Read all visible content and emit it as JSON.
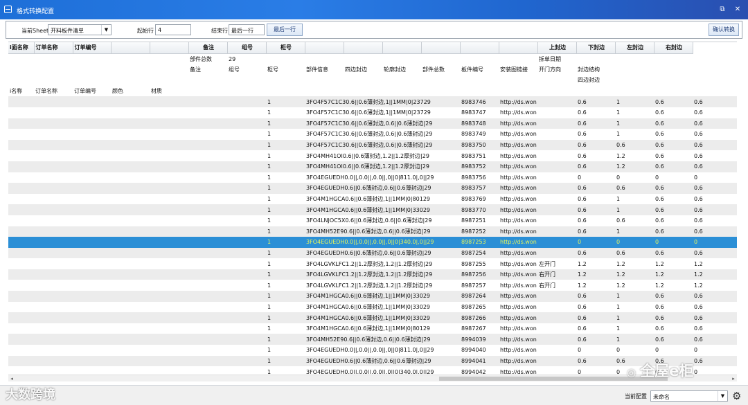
{
  "window": {
    "title": "格式转换配置",
    "restore_glyph": "⧉",
    "close_glyph": "✕"
  },
  "toolbar": {
    "sheet_label": "当前Sheet",
    "sheet_value": "开料板件清单",
    "start_label": "起始行",
    "start_value": "4",
    "end_label": "结束行",
    "end_value": "最后一行",
    "end_button": "最后一行",
    "confirm_button": "确认转换"
  },
  "grid": {
    "headers": [
      "i面名称",
      "订单名称",
      "订单编号",
      "",
      "",
      "备注",
      "组号",
      "柜号",
      "",
      "",
      "",
      "",
      "",
      "",
      "上封边",
      "下封边",
      "左封边",
      "右封边"
    ],
    "info_rows": [
      [
        "",
        "",
        "",
        "",
        "",
        "部件总数",
        "29",
        "",
        "",
        "",
        "",
        "",
        "",
        "",
        "拆单日期",
        "",
        "",
        ""
      ],
      [
        "",
        "",
        "",
        "",
        "",
        "备注",
        "组号",
        "柜号",
        "部件信息",
        "四边封边",
        "轮廓封边",
        "部件总数",
        "板件编号",
        "安装图链接",
        "开门方向",
        "封边结构",
        "",
        ""
      ],
      [
        "",
        "",
        "",
        "",
        "",
        "",
        "",
        "",
        "",
        "",
        "",
        "",
        "",
        "",
        "",
        "四边封边",
        "",
        ""
      ],
      [
        "i名称",
        "订单名称",
        "订单编号",
        "颜色",
        "材质",
        "",
        "",
        "",
        "",
        "",
        "",
        "",
        "",
        "",
        "",
        "",
        "",
        ""
      ]
    ],
    "rows": [
      [
        "1",
        "3FO4F57C1C30.6||0.6薄封边,1||1MM|0|23729",
        "8983746",
        "http://ds.won",
        "",
        "0.6",
        "1",
        "0.6",
        "0.6"
      ],
      [
        "1",
        "3FO4F57C1C30.6||0.6薄封边,1||1MM|0|23729",
        "8983747",
        "http://ds.won",
        "",
        "0.6",
        "1",
        "0.6",
        "0.6"
      ],
      [
        "1",
        "3FO4F57C1C30.6||0.6薄封边,0.6||0.6薄封边|29",
        "8983748",
        "http://ds.won",
        "",
        "0.6",
        "1",
        "0.6",
        "0.6"
      ],
      [
        "1",
        "3FO4F57C1C30.6||0.6薄封边,0.6||0.6薄封边|29",
        "8983749",
        "http://ds.won",
        "",
        "0.6",
        "1",
        "0.6",
        "0.6"
      ],
      [
        "1",
        "3FO4F57C1C30.6||0.6薄封边,0.6||0.6薄封边|29",
        "8983750",
        "http://ds.won",
        "",
        "0.6",
        "0.6",
        "0.6",
        "0.6"
      ],
      [
        "1",
        "3FO4MH41OI0.6||0.6薄封边,1.2||1.2厚封边|29",
        "8983751",
        "http://ds.won",
        "",
        "0.6",
        "1.2",
        "0.6",
        "0.6"
      ],
      [
        "1",
        "3FO4MH41OI0.6||0.6薄封边,1.2||1.2厚封边|29",
        "8983752",
        "http://ds.won",
        "",
        "0.6",
        "1.2",
        "0.6",
        "0.6"
      ],
      [
        "1",
        "3FO4EGUEDH0.0||,0.0||,0.0||,0||0|811.0|,0||29",
        "8983756",
        "http://ds.won",
        "",
        "0",
        "0",
        "0",
        "0"
      ],
      [
        "1",
        "3FO4EGUEDH0.6||0.6薄封边,0.6||0.6薄封边|29",
        "8983757",
        "http://ds.won",
        "",
        "0.6",
        "0.6",
        "0.6",
        "0.6"
      ],
      [
        "1",
        "3FO4M1HGCA0.6||0.6薄封边,1||1MM|0|80129",
        "8983769",
        "http://ds.won",
        "",
        "0.6",
        "1",
        "0.6",
        "0.6"
      ],
      [
        "1",
        "3FO4M1HGCA0.6||0.6薄封边,1||1MM|0|33029",
        "8983770",
        "http://ds.won",
        "",
        "0.6",
        "1",
        "0.6",
        "0.6"
      ],
      [
        "1",
        "3FO4LNJOC5X0.6||0.6薄封边,0.6||0.6薄封边|29",
        "8987251",
        "http://ds.won",
        "",
        "0.6",
        "0.6",
        "0.6",
        "0.6"
      ],
      [
        "1",
        "3FO4MH52E90.6||0.6薄封边,0.6||0.6薄封边|29",
        "8987252",
        "http://ds.won",
        "",
        "0.6",
        "1",
        "0.6",
        "0.6"
      ],
      [
        "1",
        "3FO4EGUEDH0.0||,0.0||,0.0||,0||0|340.0|,0||29",
        "8987253",
        "http://ds.won",
        "",
        "0",
        "0",
        "0",
        "0"
      ],
      [
        "1",
        "3FO4EGUEDH0.6||0.6薄封边,0.6||0.6薄封边|29",
        "8987254",
        "http://ds.won",
        "",
        "0.6",
        "0.6",
        "0.6",
        "0.6"
      ],
      [
        "1",
        "3FO4LGVKLFC1.2||1.2厚封边,1.2||1.2厚封边|29",
        "8987255",
        "http://ds.won",
        "左开门",
        "1.2",
        "1.2",
        "1.2",
        "1.2"
      ],
      [
        "1",
        "3FO4LGVKLFC1.2||1.2厚封边,1.2||1.2厚封边|29",
        "8987256",
        "http://ds.won",
        "右开门",
        "1.2",
        "1.2",
        "1.2",
        "1.2"
      ],
      [
        "1",
        "3FO4LGVKLFC1.2||1.2厚封边,1.2||1.2厚封边|29",
        "8987257",
        "http://ds.won",
        "右开门",
        "1.2",
        "1.2",
        "1.2",
        "1.2"
      ],
      [
        "1",
        "3FO4M1HGCA0.6||0.6薄封边,1||1MM|0|33029",
        "8987264",
        "http://ds.won",
        "",
        "0.6",
        "1",
        "0.6",
        "0.6"
      ],
      [
        "1",
        "3FO4M1HGCA0.6||0.6薄封边,1||1MM|0|33029",
        "8987265",
        "http://ds.won",
        "",
        "0.6",
        "1",
        "0.6",
        "0.6"
      ],
      [
        "1",
        "3FO4M1HGCA0.6||0.6薄封边,1||1MM|0|33029",
        "8987266",
        "http://ds.won",
        "",
        "0.6",
        "1",
        "0.6",
        "0.6"
      ],
      [
        "1",
        "3FO4M1HGCA0.6||0.6薄封边,1||1MM|0|80129",
        "8987267",
        "http://ds.won",
        "",
        "0.6",
        "1",
        "0.6",
        "0.6"
      ],
      [
        "1",
        "3FO4MH52E90.6||0.6薄封边,0.6||0.6薄封边|29",
        "8994039",
        "http://ds.won",
        "",
        "0.6",
        "1",
        "0.6",
        "0.6"
      ],
      [
        "1",
        "3FO4EGUEDH0.0||,0.0||,0.0||,0||0|811.0|,0||29",
        "8994040",
        "http://ds.won",
        "",
        "0",
        "0",
        "0",
        "0"
      ],
      [
        "1",
        "3FO4EGUEDH0.6||0.6薄封边,0.6||0.6薄封边|29",
        "8994041",
        "http://ds.won",
        "",
        "0.6",
        "0.6",
        "0.6",
        "0.6"
      ],
      [
        "1",
        "3FO4EGUEDH0.0||,0.0||,0.0||,0||0|340.0|,0||29",
        "8994042",
        "http://ds.won",
        "",
        "0",
        "0",
        "0",
        "0"
      ]
    ],
    "selected_row": 13
  },
  "status": {
    "config_label": "当前配置",
    "config_value": "未命名"
  },
  "watermarks": {
    "left": "大数跨境",
    "right": "全屋e柜"
  },
  "colors": {
    "titlebar": "#2a7de6",
    "selection": "#2b8fd6",
    "selection_text": "#e7f55a",
    "alt_row": "#ececec"
  }
}
